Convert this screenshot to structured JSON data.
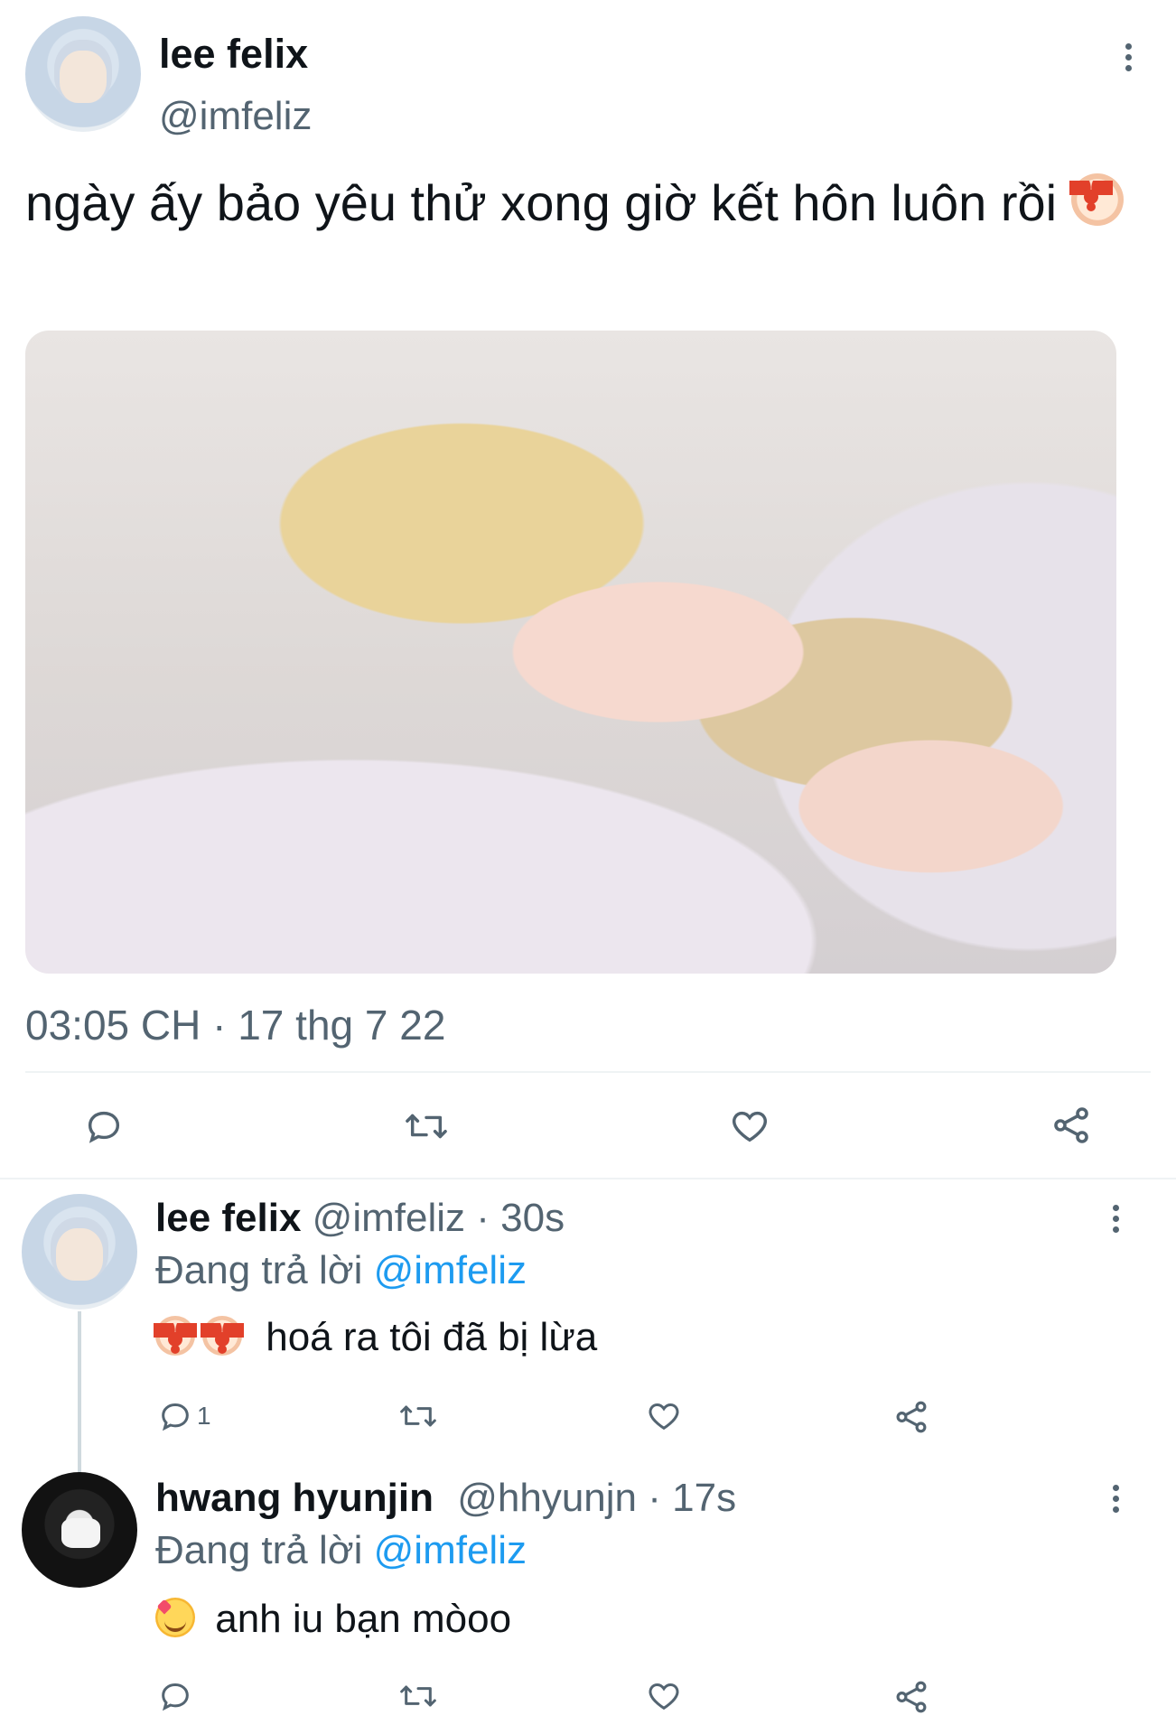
{
  "main_tweet": {
    "display_name": "lee felix",
    "handle": "@imfeliz",
    "text": "ngày ấy bảo yêu thử xong giờ kết hôn luôn rồi",
    "emoji_icon": "clown-face-icon",
    "image_alt": "photo",
    "timestamp": "03:05 CH · 17 thg 7 22",
    "actions": [
      "reply-icon",
      "retweet-icon",
      "like-icon",
      "share-icon"
    ]
  },
  "replies": [
    {
      "display_name": "lee felix",
      "handle": "@imfeliz",
      "time": "· 30s",
      "replying_prefix": "Đang trả lời",
      "replying_to": "@imfeliz",
      "text": "hoá ra tôi đã bị lừa",
      "emojis": [
        "clown-face-icon",
        "clown-face-icon"
      ],
      "reply_count": "1"
    },
    {
      "display_name": "hwang hyunjin",
      "handle": "@hhyunjn",
      "time": "· 17s",
      "replying_prefix": "Đang trả lời",
      "replying_to": "@imfeliz",
      "text": "anh iu bạn mòoo",
      "emojis": [
        "smiling-face-with-hearts-icon"
      ],
      "reply_count": ""
    }
  ],
  "colors": {
    "link": "#1d9bf0",
    "muted": "#536471",
    "text": "#0f1419"
  }
}
